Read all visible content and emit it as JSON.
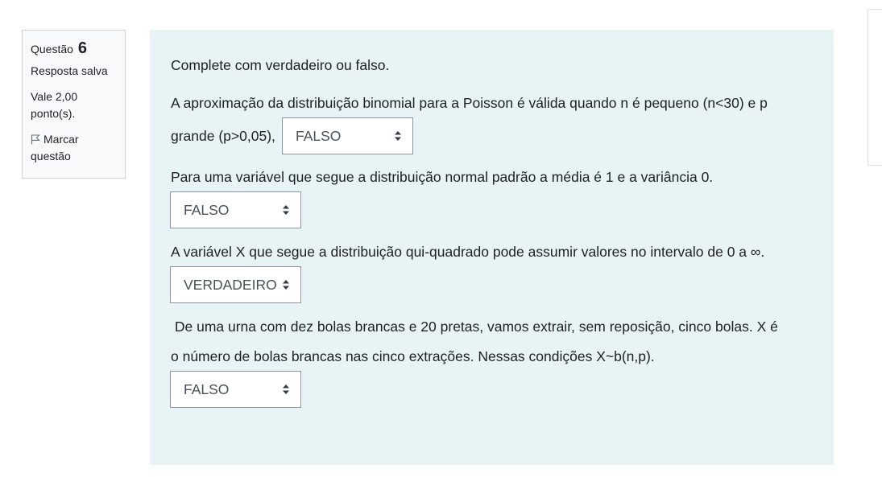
{
  "question_info": {
    "label": "Questão",
    "number": "6",
    "state": "Resposta salva",
    "grade": "Vale 2,00 ponto(s).",
    "flag_label": "Marcar questão"
  },
  "content": {
    "instruction": "Complete com verdadeiro ou falso.",
    "q1_line1": "A aproximação da distribuição binomial para a Poisson é válida quando n é pequeno (n<30) e p",
    "q1_line2": "grande (p>0,05),",
    "q1_answer": "FALSO",
    "q2_text": "Para uma variável que segue a distribuição normal padrão a média é 1 e a variância 0.",
    "q2_answer": "FALSO",
    "q3_text": "A variável X que segue a distribuição qui-quadrado pode assumir valores no intervalo de 0 a ∞.",
    "q3_answer": "VERDADEIRO",
    "q4_line1": " De uma urna com dez bolas brancas e 20 pretas, vamos extrair, sem reposição, cinco bolas. X é",
    "q4_line2": "o número de bolas brancas nas cinco extrações. Nessas condições X~b(n,p).",
    "q4_answer": "FALSO"
  },
  "icons": {
    "flag": "flag-icon",
    "select_caret": "sort-caret-icon"
  }
}
